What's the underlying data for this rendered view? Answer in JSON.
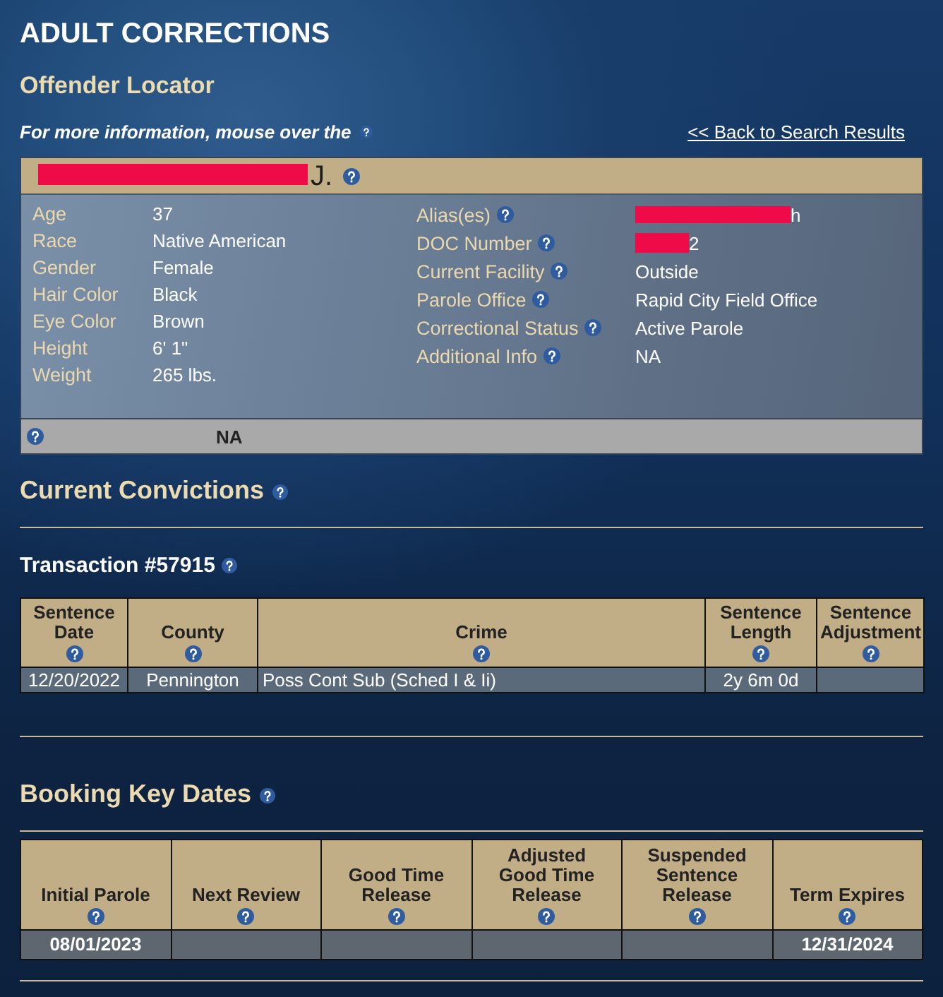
{
  "page": {
    "title": "ADULT CORRECTIONS",
    "subtitle": "Offender Locator",
    "info": {
      "text": "For more information, mouse over the",
      "help": true
    },
    "back_link": "<< Back to Search Results"
  },
  "offender": {
    "name": {
      "text": "J.",
      "redacted": true,
      "help": true
    },
    "details_left": [
      {
        "label": "Age",
        "value": "37"
      },
      {
        "label": "Race",
        "value": "Native American"
      },
      {
        "label": "Gender",
        "value": "Female"
      },
      {
        "label": "Hair Color",
        "value": "Black"
      },
      {
        "label": "Eye Color",
        "value": "Brown"
      },
      {
        "label": "Height",
        "value": "6' 1\""
      },
      {
        "label": "Weight",
        "value": "265 lbs."
      }
    ],
    "details_right": [
      {
        "label": "Alias(es)",
        "help": true,
        "value": "h",
        "redacted": true
      },
      {
        "label": "DOC Number",
        "help": true,
        "value": "2",
        "redacted": true
      },
      {
        "label": "Current Facility",
        "help": true,
        "value": "Outside",
        "redacted": false
      },
      {
        "label": "Parole Office",
        "help": true,
        "value": "Rapid City Field Office",
        "redacted": false
      },
      {
        "label": "Correctional Status",
        "help": true,
        "value": "Active Parole",
        "redacted": false
      },
      {
        "label": "Additional Info",
        "help": true,
        "value": "NA",
        "redacted": false
      }
    ],
    "footer": {
      "help": true,
      "value": "NA"
    }
  },
  "convictions": {
    "title": "Current Convictions",
    "help": true,
    "transaction": {
      "title": "Transaction #57915",
      "help": true
    },
    "table": {
      "columns": [
        {
          "lines": [
            "Sentence",
            "Date"
          ],
          "help": true
        },
        {
          "lines": [
            "County"
          ],
          "help": true
        },
        {
          "lines": [
            "Crime"
          ],
          "help": true
        },
        {
          "lines": [
            "Sentence",
            "Length"
          ],
          "help": true
        },
        {
          "lines": [
            "Sentence",
            "Adjustment"
          ],
          "help": true
        }
      ],
      "rows": [
        [
          "12/20/2022",
          "Pennington",
          "Poss Cont Sub (Sched I & Ii)",
          "2y 6m 0d",
          null
        ]
      ]
    }
  },
  "booking_dates": {
    "title": "Booking Key Dates",
    "help": true,
    "table": {
      "columns": [
        {
          "lines": [
            "Initial Parole"
          ],
          "help": true
        },
        {
          "lines": [
            "Next Review"
          ],
          "help": true
        },
        {
          "lines": [
            "Good Time",
            "Release"
          ],
          "help": true
        },
        {
          "lines": [
            "Adjusted",
            "Good Time",
            "Release"
          ],
          "help": true
        },
        {
          "lines": [
            "Suspended",
            "Sentence",
            "Release"
          ],
          "help": true
        },
        {
          "lines": [
            "Term Expires"
          ],
          "help": true
        }
      ],
      "rows": [
        [
          "08/01/2023",
          null,
          null,
          null,
          null,
          "12/31/2024"
        ]
      ]
    }
  }
}
